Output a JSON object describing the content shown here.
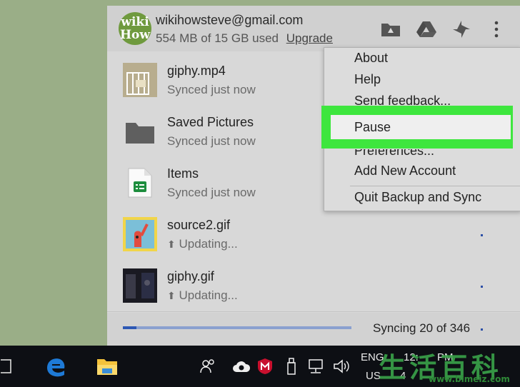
{
  "account": {
    "avatar_text_1": "wiki",
    "avatar_text_2": "How",
    "email": "wikihowsteve@gmail.com",
    "usage": "554 MB of 15 GB used",
    "upgrade_label": "Upgrade"
  },
  "header_icons": [
    "folder-icon",
    "google-drive-icon",
    "google-photos-icon",
    "more-vert-icon"
  ],
  "files": [
    {
      "name": "giphy.mp4",
      "status": "Synced just now",
      "thumb": "video-thumbnail"
    },
    {
      "name": "Saved Pictures",
      "status": "Synced just now",
      "thumb": "folder-icon"
    },
    {
      "name": "Items",
      "status": "Synced just now",
      "thumb": "sheets-icon"
    },
    {
      "name": "source2.gif",
      "status": "Updating...",
      "thumb": "gif-thumbnail"
    },
    {
      "name": "giphy.gif",
      "status": "Updating...",
      "thumb": "gif-thumbnail"
    }
  ],
  "footer": {
    "sync_status": "Syncing 20 of 346",
    "progress_fraction": 0.06
  },
  "menu": {
    "items": [
      "About",
      "Help",
      "Send feedback...",
      "Pause",
      "Preferences...",
      "Add New Account",
      "Quit Backup and Sync"
    ],
    "highlighted": "Pause",
    "highlight_color": "#3ee63e"
  },
  "taskbar": {
    "lang_line1": "ENG",
    "lang_line2": "US",
    "time": "12:",
    "time_suffix": "PM",
    "date_partial": "4"
  },
  "watermark": {
    "chars": "生 活 百 科",
    "url": "www.bimeiz.com"
  }
}
